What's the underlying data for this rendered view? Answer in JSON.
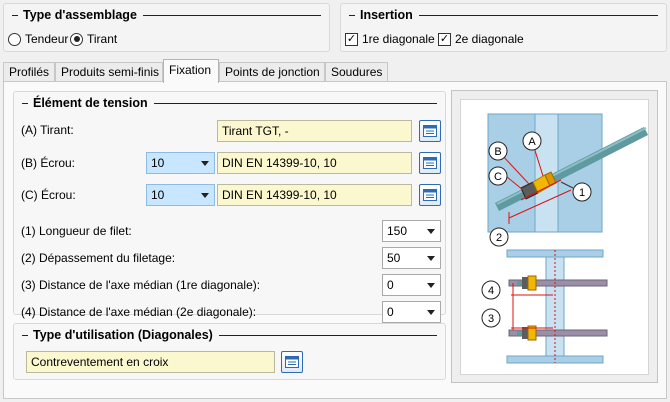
{
  "assembly_type": {
    "title": "Type d'assemblage",
    "options": [
      "Tendeur",
      "Tirant"
    ],
    "selected": "Tirant"
  },
  "insertion": {
    "title": "Insertion",
    "checkboxes": [
      {
        "label": "1re diagonale",
        "checked": true
      },
      {
        "label": "2e diagonale",
        "checked": true
      }
    ]
  },
  "tabs": [
    "Profilés",
    "Produits semi-finis",
    "Fixation",
    "Points de jonction",
    "Soudures"
  ],
  "active_tab": "Fixation",
  "tension_element": {
    "title": "Élément de tension",
    "tirant": {
      "label": "(A) Tirant:",
      "value": "Tirant TGT, -"
    },
    "ecrou_b": {
      "label": "(B) Écrou:",
      "size": "10",
      "value": "DIN EN 14399-10, 10"
    },
    "ecrou_c": {
      "label": "(C) Écrou:",
      "size": "10",
      "value": "DIN EN 14399-10, 10"
    },
    "params": [
      {
        "label": "(1) Longueur de filet:",
        "value": "150"
      },
      {
        "label": "(2) Dépassement du filetage:",
        "value": "50"
      },
      {
        "label": "(3) Distance de l'axe médian (1re diagonale):",
        "value": "0"
      },
      {
        "label": "(4) Distance de l'axe médian (2e diagonale):",
        "value": "0"
      }
    ]
  },
  "usage_type": {
    "title": "Type d'utilisation (Diagonales)",
    "value": "Contreventement en croix"
  },
  "diagram_labels": [
    "A",
    "B",
    "C",
    "1",
    "2",
    "3",
    "4"
  ],
  "colors": {
    "field_yellow": "#fbf8cf",
    "combo_blue": "#c8e6ff",
    "steel_blue": "#a9cfe6",
    "rod_green": "#5f9aa0",
    "nut_yellow": "#f2b705",
    "dimension_red": "#e01010"
  }
}
